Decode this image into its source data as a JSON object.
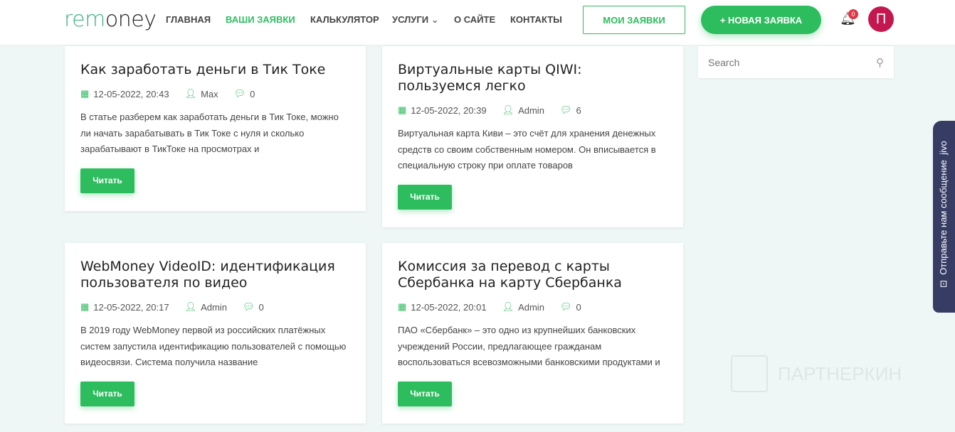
{
  "header": {
    "logo": {
      "pre": "re",
      "mid": "m",
      "post": "oney"
    },
    "nav": [
      "ГЛАВНАЯ",
      "ВАШИ ЗАЯВКИ",
      "КАЛЬКУЛЯТОР",
      "УСЛУГИ",
      "О САЙТЕ",
      "КОНТАКТЫ"
    ],
    "my_requests": "МОИ ЗАЯВКИ",
    "new_request": "+ НОВАЯ ЗАЯВКА",
    "notifications": "0",
    "avatar": "П"
  },
  "colors": {
    "accent": "#2dbd5e",
    "avatar": "#c4164f",
    "chat": "#363c63"
  },
  "posts": [
    {
      "title": "Как заработать деньги в Тик Токе",
      "date": "12-05-2022, 20:43",
      "author": "Max",
      "comments": "0",
      "excerpt": "В статье разберем как заработать деньги в Тик Токе, можно ли начать зарабатывать в Тик Токе с нуля и сколько зарабатывают в ТикТоке на просмотрах и",
      "read": "Читать"
    },
    {
      "title": "Виртуальные карты QIWI: пользуемся легко",
      "date": "12-05-2022, 20:39",
      "author": "Admin",
      "comments": "6",
      "excerpt": "Виртуальная карта Киви – это счёт для хранения денежных средств со своим собственным номером. Он вписывается в специальную строку при оплате товаров",
      "read": "Читать"
    },
    {
      "title": "WebMoney VideoID: идентификация пользователя по видео",
      "date": "12-05-2022, 20:17",
      "author": "Admin",
      "comments": "0",
      "excerpt": "В 2019 году WebMoney первой из российских платёжных систем запустила идентификацию пользователей с помощью видеосвязи. Система получила название",
      "read": "Читать"
    },
    {
      "title": "Комиссия за перевод с карты Сбербанка на карту Сбербанка",
      "date": "12-05-2022, 20:01",
      "author": "Admin",
      "comments": "0",
      "excerpt": "ПАО «Сбербанк» – это одно из крупнейших банковских учреждений России, предлагающее гражданам воспользоваться всевозможными банковскими продуктами и",
      "read": "Читать"
    }
  ],
  "search": {
    "placeholder": "Search"
  },
  "chat": {
    "label": "Отправьте нам сообщение",
    "brand": "jivo"
  },
  "watermark": "ПАРТНЕРКИН"
}
